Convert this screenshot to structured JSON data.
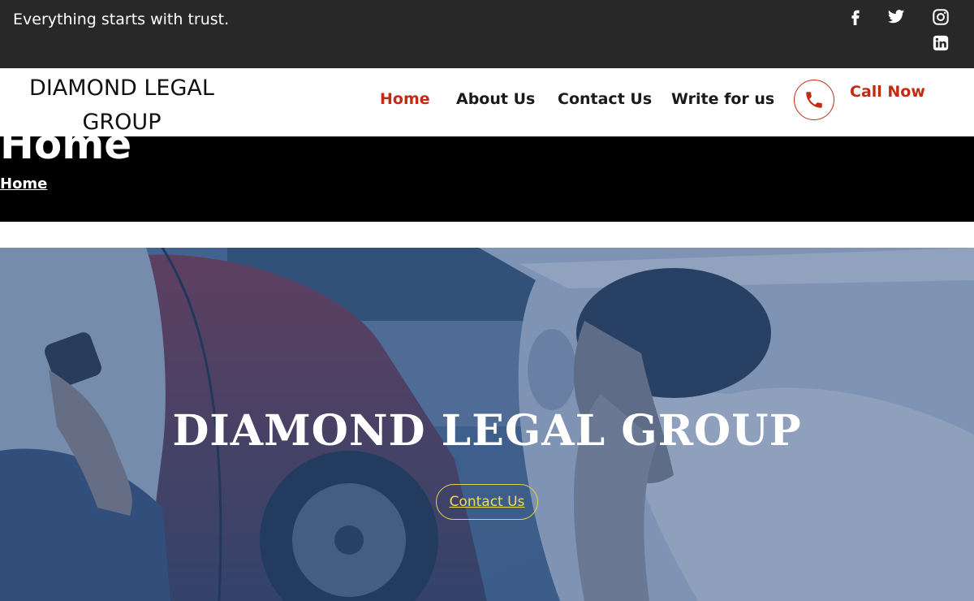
{
  "topbar": {
    "tagline": "Everything starts with trust.",
    "social": [
      {
        "icon": "facebook-icon"
      },
      {
        "icon": "twitter-icon"
      },
      {
        "icon": "instagram-icon"
      },
      {
        "icon": "linkedin-icon"
      }
    ]
  },
  "header": {
    "logo": "DIAMOND LEGAL GROUP",
    "nav": [
      {
        "label": "Home",
        "active": true
      },
      {
        "label": "About Us"
      },
      {
        "label": "Contact Us"
      },
      {
        "label": "Write for us"
      }
    ],
    "phone_icon": "phone-icon",
    "call_label": "Call Now"
  },
  "title_band": {
    "title": "Home",
    "breadcrumb": "Home"
  },
  "hero": {
    "title": "DIAMOND LEGAL GROUP",
    "button_label": "Contact Us"
  },
  "colors": {
    "topbar_bg": "#282828",
    "accent_red": "#c42a12",
    "button_yellow": "#f2dc52",
    "hero_tint": "#284878"
  }
}
